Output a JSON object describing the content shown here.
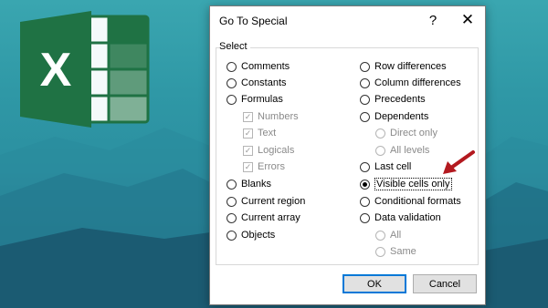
{
  "dialog": {
    "title": "Go To Special",
    "help_label": "?",
    "close_label": "✕",
    "group_label": "Select"
  },
  "left_options": [
    {
      "label": "Comments",
      "checked": false
    },
    {
      "label": "Constants",
      "checked": false
    },
    {
      "label": "Formulas",
      "checked": false
    }
  ],
  "formula_types": [
    {
      "label": "Numbers",
      "checked": true
    },
    {
      "label": "Text",
      "checked": true
    },
    {
      "label": "Logicals",
      "checked": true
    },
    {
      "label": "Errors",
      "checked": true
    }
  ],
  "left_options_2": [
    {
      "label": "Blanks",
      "checked": false
    },
    {
      "label": "Current region",
      "checked": false
    },
    {
      "label": "Current array",
      "checked": false
    },
    {
      "label": "Objects",
      "checked": false
    }
  ],
  "right_options": [
    {
      "label": "Row differences",
      "checked": false
    },
    {
      "label": "Column differences",
      "checked": false
    },
    {
      "label": "Precedents",
      "checked": false
    },
    {
      "label": "Dependents",
      "checked": false
    }
  ],
  "dependents_sub": [
    {
      "label": "Direct only"
    },
    {
      "label": "All levels"
    }
  ],
  "right_options_2": [
    {
      "label": "Last cell",
      "checked": false
    },
    {
      "label": "Visible cells only",
      "checked": true
    },
    {
      "label": "Conditional formats",
      "checked": false
    },
    {
      "label": "Data validation",
      "checked": false
    }
  ],
  "validation_sub": [
    {
      "label": "All"
    },
    {
      "label": "Same"
    }
  ],
  "buttons": {
    "ok": "OK",
    "cancel": "Cancel"
  },
  "colors": {
    "excel_green": "#1f7244",
    "arrow_red": "#b3191f"
  },
  "logo": {
    "letter": "X"
  }
}
